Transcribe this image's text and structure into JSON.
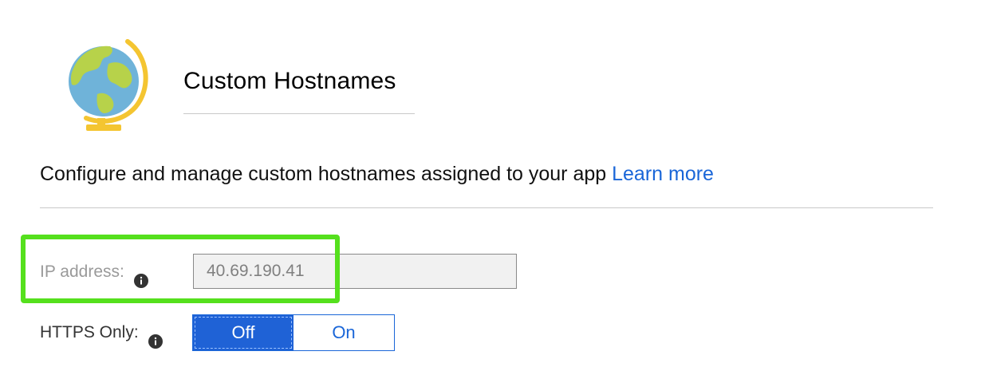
{
  "header": {
    "title": "Custom Hostnames",
    "icon": "globe-icon"
  },
  "description": {
    "text": "Configure and manage custom hostnames assigned to your app ",
    "link_label": "Learn more"
  },
  "ip_address": {
    "label": "IP address:",
    "value": "40.69.190.41",
    "info_icon": "info-icon"
  },
  "https_only": {
    "label": "HTTPS Only:",
    "info_icon": "info-icon",
    "options": [
      "Off",
      "On"
    ],
    "selected": "Off"
  },
  "colors": {
    "accent": "#1f62d6",
    "highlight": "#55e01d",
    "link": "#1a66d8"
  }
}
